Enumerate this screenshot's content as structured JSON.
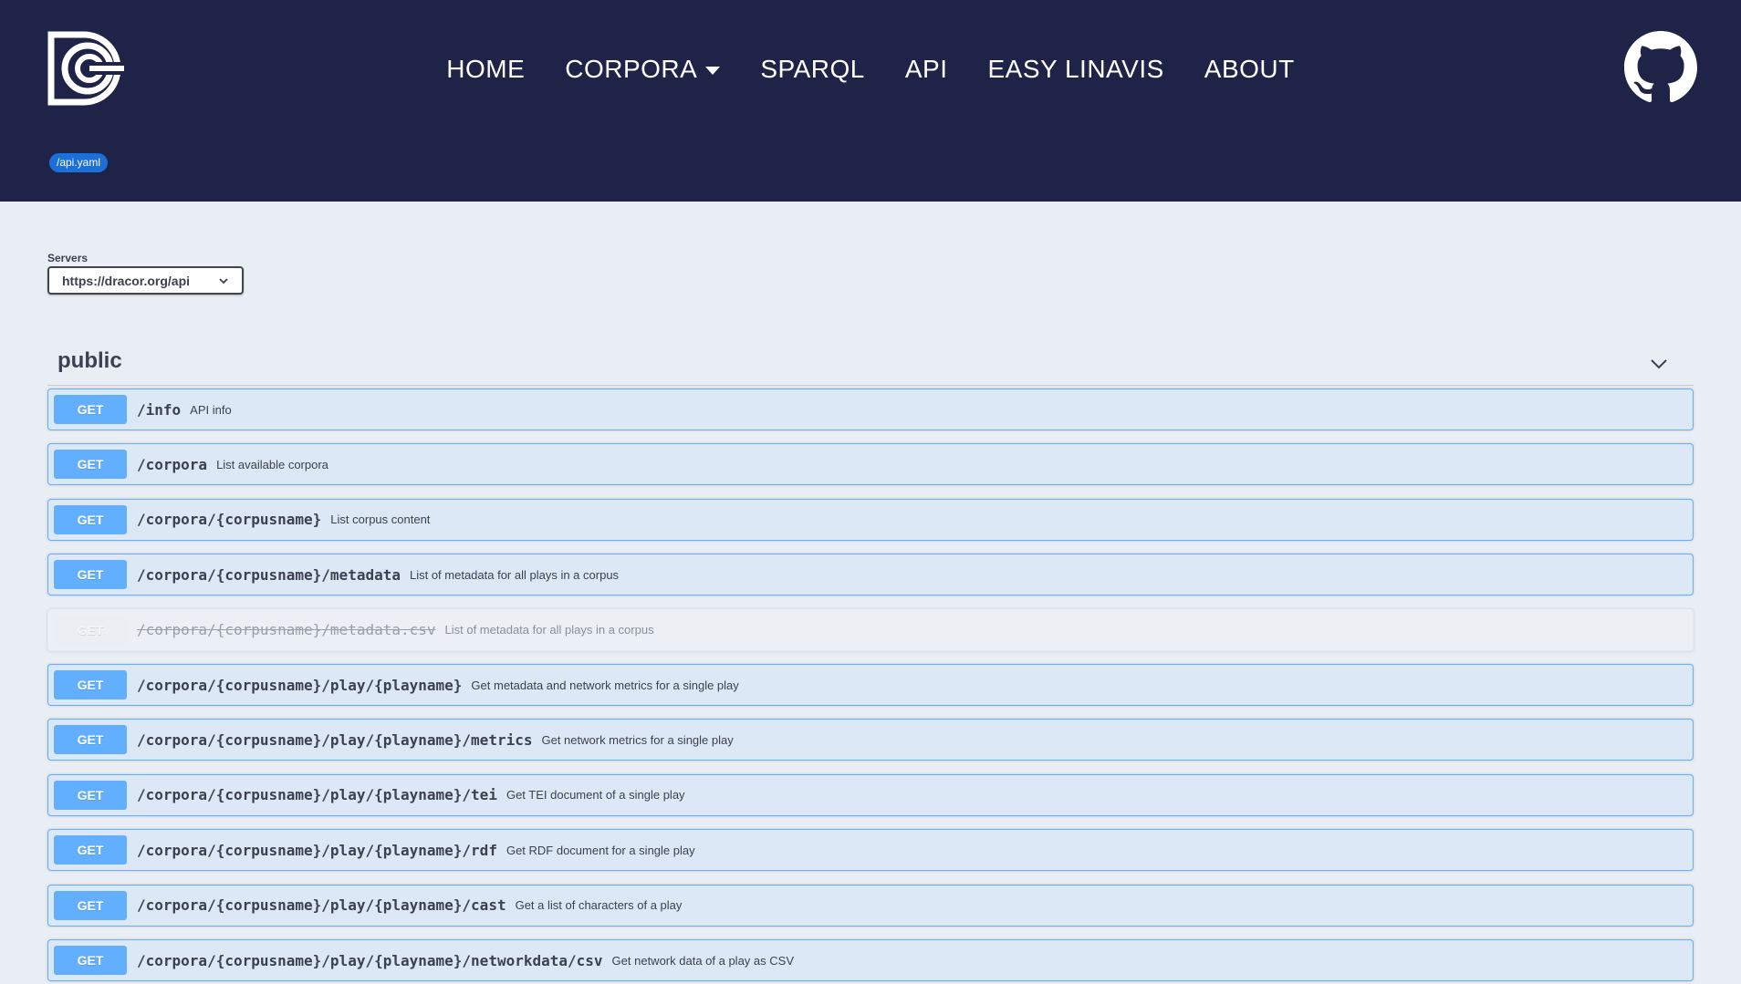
{
  "header": {
    "nav": [
      {
        "label": "HOME",
        "dropdown": false
      },
      {
        "label": "CORPORA",
        "dropdown": true
      },
      {
        "label": "SPARQL",
        "dropdown": false
      },
      {
        "label": "API",
        "dropdown": false
      },
      {
        "label": "EASY LINAVIS",
        "dropdown": false
      },
      {
        "label": "ABOUT",
        "dropdown": false
      }
    ],
    "spec_link": "/api.yaml",
    "logo_icon": "dracor-logo-icon",
    "github_icon": "github-icon"
  },
  "servers": {
    "label": "Servers",
    "selected": "https://dracor.org/api"
  },
  "section": {
    "title": "public"
  },
  "operations": [
    {
      "method": "GET",
      "path": "/info",
      "summary": "API info",
      "deprecated": false
    },
    {
      "method": "GET",
      "path": "/corpora",
      "summary": "List available corpora",
      "deprecated": false
    },
    {
      "method": "GET",
      "path": "/corpora/{corpusname}",
      "summary": "List corpus content",
      "deprecated": false
    },
    {
      "method": "GET",
      "path": "/corpora/{corpusname}/metadata",
      "summary": "List of metadata for all plays in a corpus",
      "deprecated": false
    },
    {
      "method": "GET",
      "path": "/corpora/{corpusname}/metadata.csv",
      "summary": "List of metadata for all plays in a corpus",
      "deprecated": true
    },
    {
      "method": "GET",
      "path": "/corpora/{corpusname}/play/{playname}",
      "summary": "Get metadata and network metrics for a single play",
      "deprecated": false
    },
    {
      "method": "GET",
      "path": "/corpora/{corpusname}/play/{playname}/metrics",
      "summary": "Get network metrics for a single play",
      "deprecated": false
    },
    {
      "method": "GET",
      "path": "/corpora/{corpusname}/play/{playname}/tei",
      "summary": "Get TEI document of a single play",
      "deprecated": false
    },
    {
      "method": "GET",
      "path": "/corpora/{corpusname}/play/{playname}/rdf",
      "summary": "Get RDF document for a single play",
      "deprecated": false
    },
    {
      "method": "GET",
      "path": "/corpora/{corpusname}/play/{playname}/cast",
      "summary": "Get a list of characters of a play",
      "deprecated": false
    },
    {
      "method": "GET",
      "path": "/corpora/{corpusname}/play/{playname}/networkdata/csv",
      "summary": "Get network data of a play as CSV",
      "deprecated": false
    }
  ]
}
